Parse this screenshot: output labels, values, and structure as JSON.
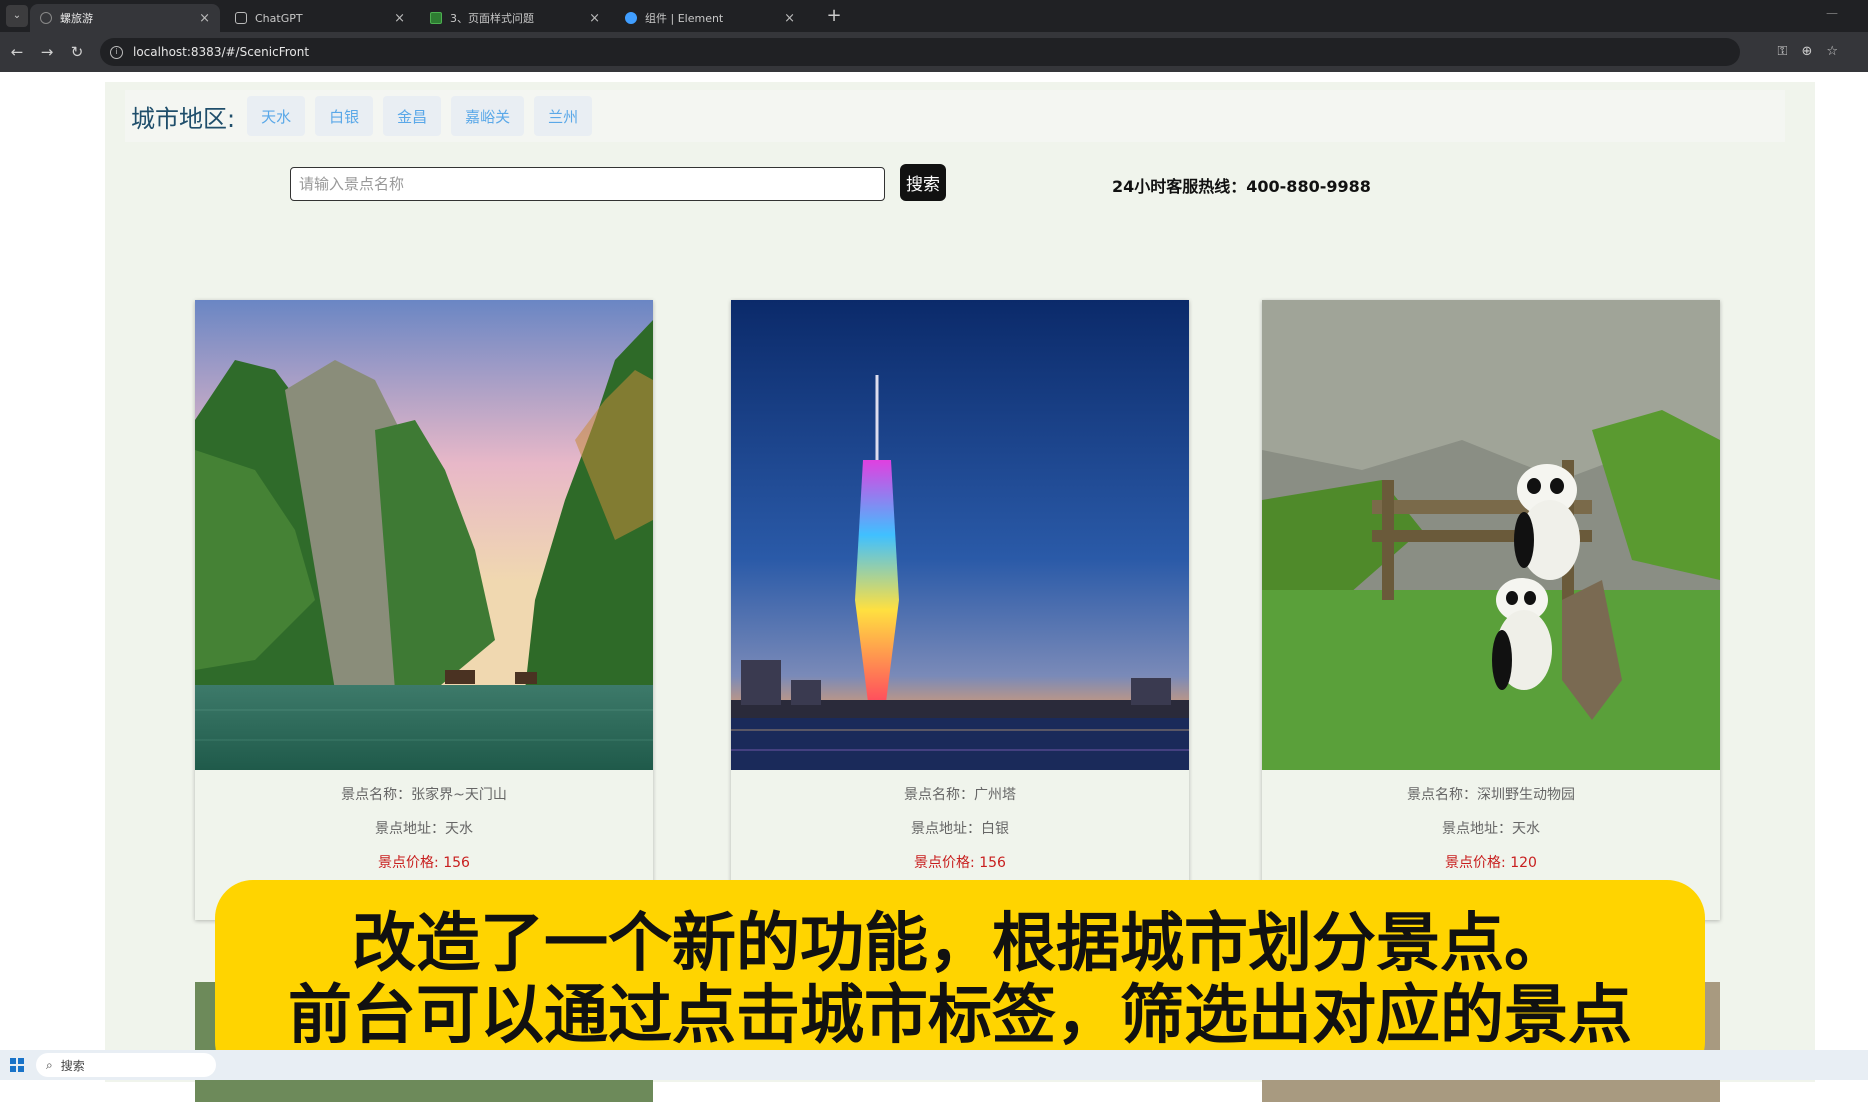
{
  "browser": {
    "tabs": [
      {
        "title": "螺旅游",
        "active": true
      },
      {
        "title": "ChatGPT",
        "active": false
      },
      {
        "title": "3、页面样式问题",
        "active": false
      },
      {
        "title": "组件 | Element",
        "active": false
      }
    ],
    "new_tab": "+",
    "url": "localhost:8383/#/ScenicFront"
  },
  "filter": {
    "label": "城市地区:",
    "cities": [
      "天水",
      "白银",
      "金昌",
      "嘉峪关",
      "兰州"
    ]
  },
  "search": {
    "placeholder": "请输入景点名称",
    "button_label": "搜索",
    "hotline": "24小时客服热线：400-880-9988"
  },
  "cards": [
    {
      "name": "景点名称：张家界~天门山",
      "address": "景点地址：天水",
      "price": "景点价格: 156"
    },
    {
      "name": "景点名称：广州塔",
      "address": "景点地址：白银",
      "price": "景点价格: 156"
    },
    {
      "name": "景点名称：深圳野生动物园",
      "address": "景点地址：天水",
      "price": "景点价格: 120"
    }
  ],
  "subtitle": {
    "line1": "改造了一个新的功能，根据城市划分景点。",
    "line2": "前台可以通过点击城市标签，筛选出对应的景点"
  },
  "taskbar": {
    "search_label": "搜索"
  }
}
